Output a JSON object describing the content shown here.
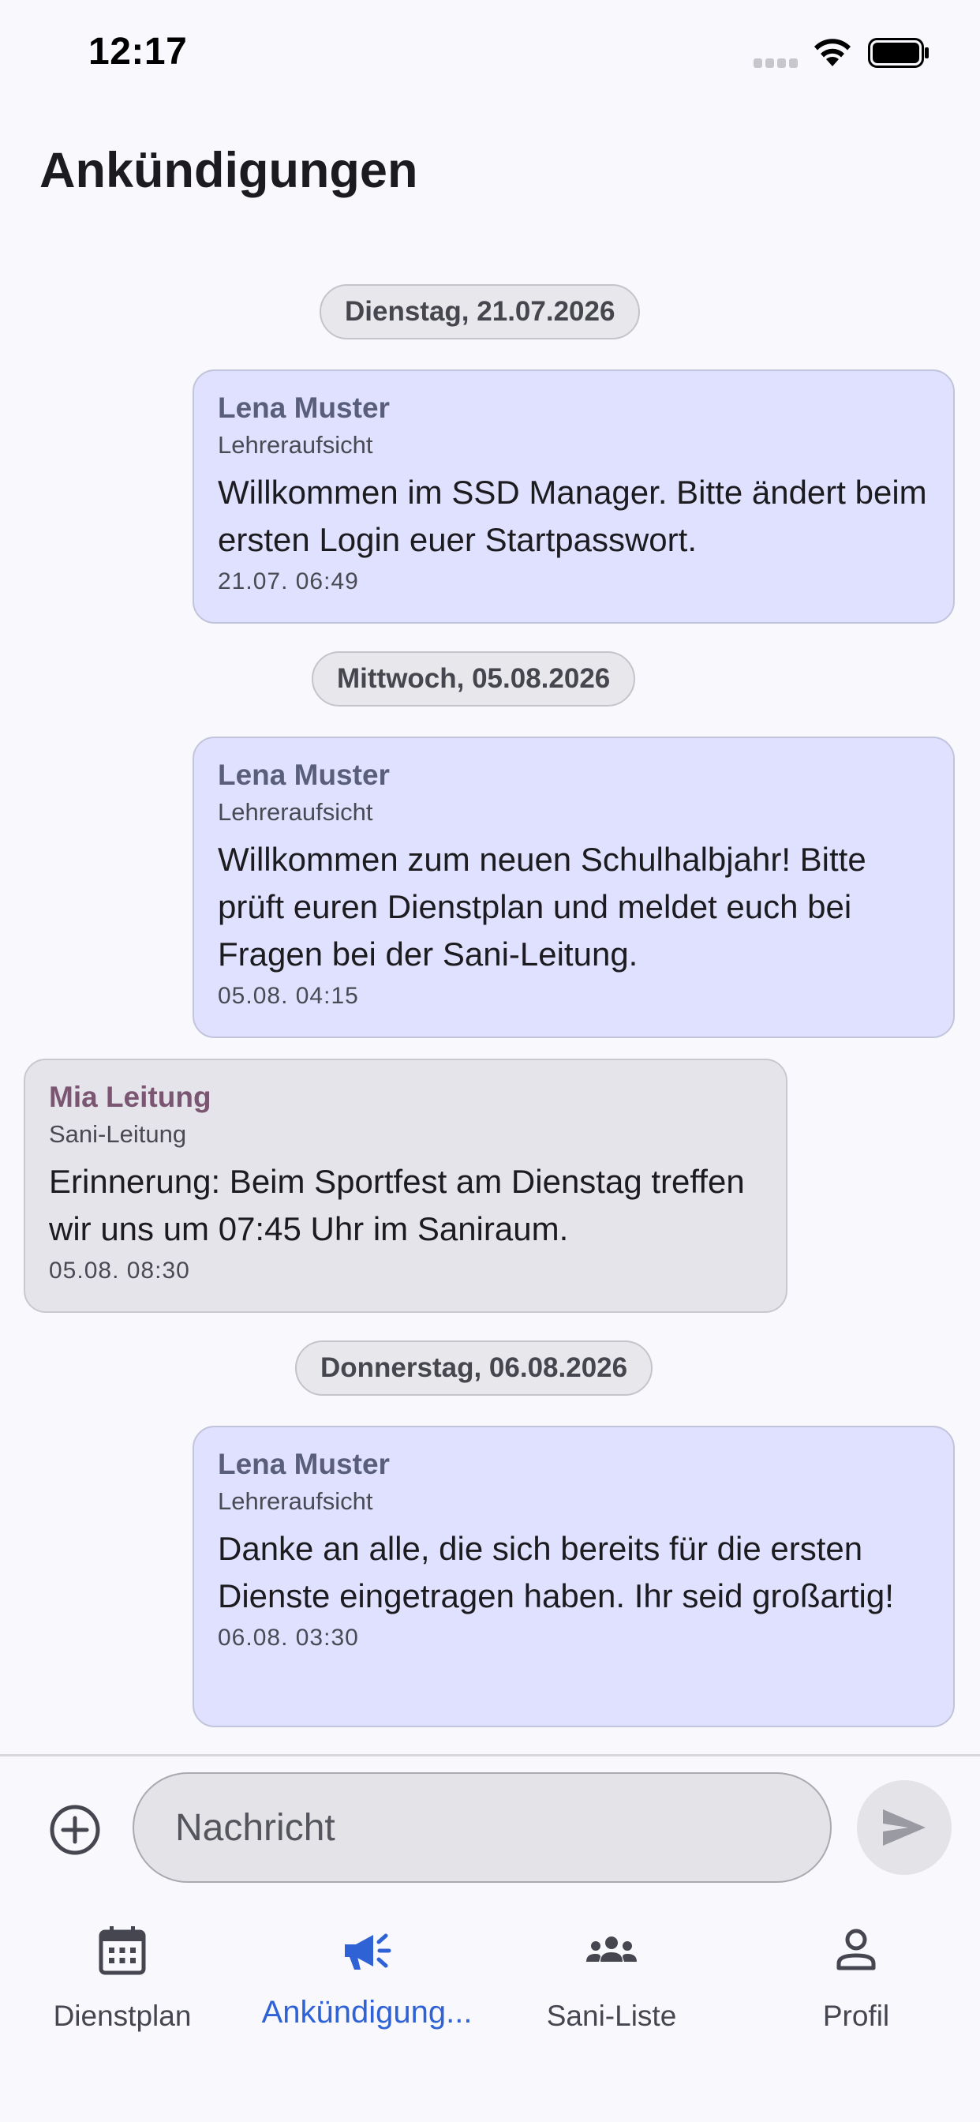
{
  "status_bar": {
    "time": "12:17"
  },
  "header": {
    "title": "Ankündigungen"
  },
  "messages": {
    "date1": "Dienstag, 21.07.2026",
    "msg1": {
      "sender": "Lena Muster",
      "role": "Lehreraufsicht",
      "text": "Willkommen im SSD Manager. Bitte ändert beim ersten Login euer Startpasswort.",
      "time": "21.07. 06:49"
    },
    "date2": "Mittwoch, 05.08.2026",
    "msg2": {
      "sender": "Lena Muster",
      "role": "Lehreraufsicht",
      "text": "Willkommen zum neuen Schulhalbjahr! Bitte prüft euren Dienstplan und meldet euch bei Fragen bei der Sani-Leitung.",
      "time": "05.08. 04:15"
    },
    "msg3": {
      "sender": "Mia Leitung",
      "role": "Sani-Leitung",
      "text": "Erinnerung: Beim Sportfest am Dienstag treffen wir uns um 07:45 Uhr im Saniraum.",
      "time": "05.08. 08:30"
    },
    "date3": "Donnerstag, 06.08.2026",
    "msg4": {
      "sender": "Lena Muster",
      "role": "Lehreraufsicht",
      "text": "Danke an alle, die sich bereits für die ersten Dienste eingetragen haben. Ihr seid großartig!",
      "time": "06.08. 03:30"
    }
  },
  "composer": {
    "placeholder": "Nachricht",
    "add_icon": "add-circle-icon",
    "send_icon": "send-icon"
  },
  "nav": {
    "items": [
      {
        "label": "Dienstplan",
        "icon": "calendar-icon"
      },
      {
        "label": "Ankündigung...",
        "icon": "megaphone-icon"
      },
      {
        "label": "Sani-Liste",
        "icon": "group-icon"
      },
      {
        "label": "Profil",
        "icon": "person-icon"
      }
    ],
    "active_index": 1
  },
  "colors": {
    "accent": "#2f62d4",
    "own_bubble": "#dfe1fe",
    "other_bubble": "#e5e4ea"
  }
}
